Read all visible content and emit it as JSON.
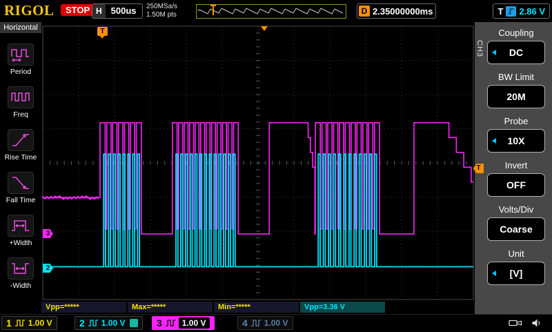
{
  "colors": {
    "ch1": "#f5e400",
    "ch2": "#00e5ff",
    "ch3": "#ff22ff",
    "ch4": "#5b7fa6",
    "trigger_orange": "#ff9100",
    "logo_gold": "#f6c613",
    "stop_red": "#dd0000",
    "menu_bg": "#484848"
  },
  "top_bar": {
    "logo": "RIGOL",
    "run_state": "STOP",
    "h_label": "H",
    "timebase": "500us",
    "sample_rate": "250MSa/s",
    "mem_depth": "1.50M pts",
    "d_label": "D",
    "delay": "2.35000000ms",
    "t_label": "T",
    "trigger_level": "2.86 V"
  },
  "left_sidebar": {
    "title": "Horizontal",
    "items": [
      {
        "label": "Period"
      },
      {
        "label": "Freq"
      },
      {
        "label": "Rise Time"
      },
      {
        "label": "Fall Time"
      },
      {
        "label": "+Width"
      },
      {
        "label": "-Width"
      }
    ]
  },
  "plot": {
    "trigger_flag": "T",
    "trigger_tab": "T",
    "ch2_tab": "2",
    "ch3_tab": "3"
  },
  "right_menu": {
    "channel": "CH3",
    "items": [
      {
        "title": "Coupling",
        "value": "DC",
        "arrow": true
      },
      {
        "title": "BW Limit",
        "value": "20M",
        "arrow": false
      },
      {
        "title": "Probe",
        "value": "10X",
        "arrow": true
      },
      {
        "title": "Invert",
        "value": "OFF",
        "arrow": false
      },
      {
        "title": "Volts/Div",
        "value": "Coarse",
        "arrow": false
      },
      {
        "title": "Unit",
        "value": "[V]",
        "arrow": true
      }
    ]
  },
  "measurements": [
    {
      "label": "Vpp=*****",
      "source": "CH1"
    },
    {
      "label": "Max=*****",
      "source": "CH1"
    },
    {
      "label": "Min=*****",
      "source": "CH1"
    },
    {
      "label": "Vpp=3.36 V",
      "source": "CH2"
    }
  ],
  "channels": [
    {
      "num": "1",
      "scale": "1.00 V"
    },
    {
      "num": "2",
      "scale": "1.00 V"
    },
    {
      "num": "3",
      "scale": "1.00 V"
    },
    {
      "num": "4",
      "scale": "1.00 V"
    }
  ],
  "waveforms": {
    "grid": {
      "cols": 12,
      "rows": 8
    },
    "ch3": {
      "color": "#ff22ff",
      "levels": {
        "mid": 0.627,
        "high": 0.353,
        "low": 0.76,
        "dip": 0.742,
        "decay": 0.57
      },
      "intro_end": 0.133,
      "events": [
        {
          "t": "burst",
          "x0": 0.133,
          "x1": 0.229,
          "n": 6
        },
        {
          "t": "flat",
          "x1": 0.301
        },
        {
          "t": "burst",
          "x0": 0.301,
          "x1": 0.454,
          "n": 11
        },
        {
          "t": "flat",
          "x1": 0.526
        },
        {
          "t": "wide",
          "x0": 0.526,
          "x1": 0.611,
          "dx1": 0.632,
          "drop": true
        },
        {
          "t": "burst",
          "x0": 0.633,
          "x1": 0.782,
          "n": 10
        },
        {
          "t": "flat",
          "x1": 0.862
        },
        {
          "t": "wide",
          "x0": 0.862,
          "x1": 0.926,
          "dx1": 0.995,
          "drop": false
        }
      ]
    },
    "ch2": {
      "color": "#00e5ff",
      "base": 0.88,
      "top": 0.468,
      "bursts": [
        {
          "x0": 0.138,
          "x1": 0.228,
          "n": 8
        },
        {
          "x0": 0.306,
          "x1": 0.45,
          "n": 13
        },
        {
          "x0": 0.636,
          "x1": 0.779,
          "n": 12
        }
      ]
    }
  }
}
